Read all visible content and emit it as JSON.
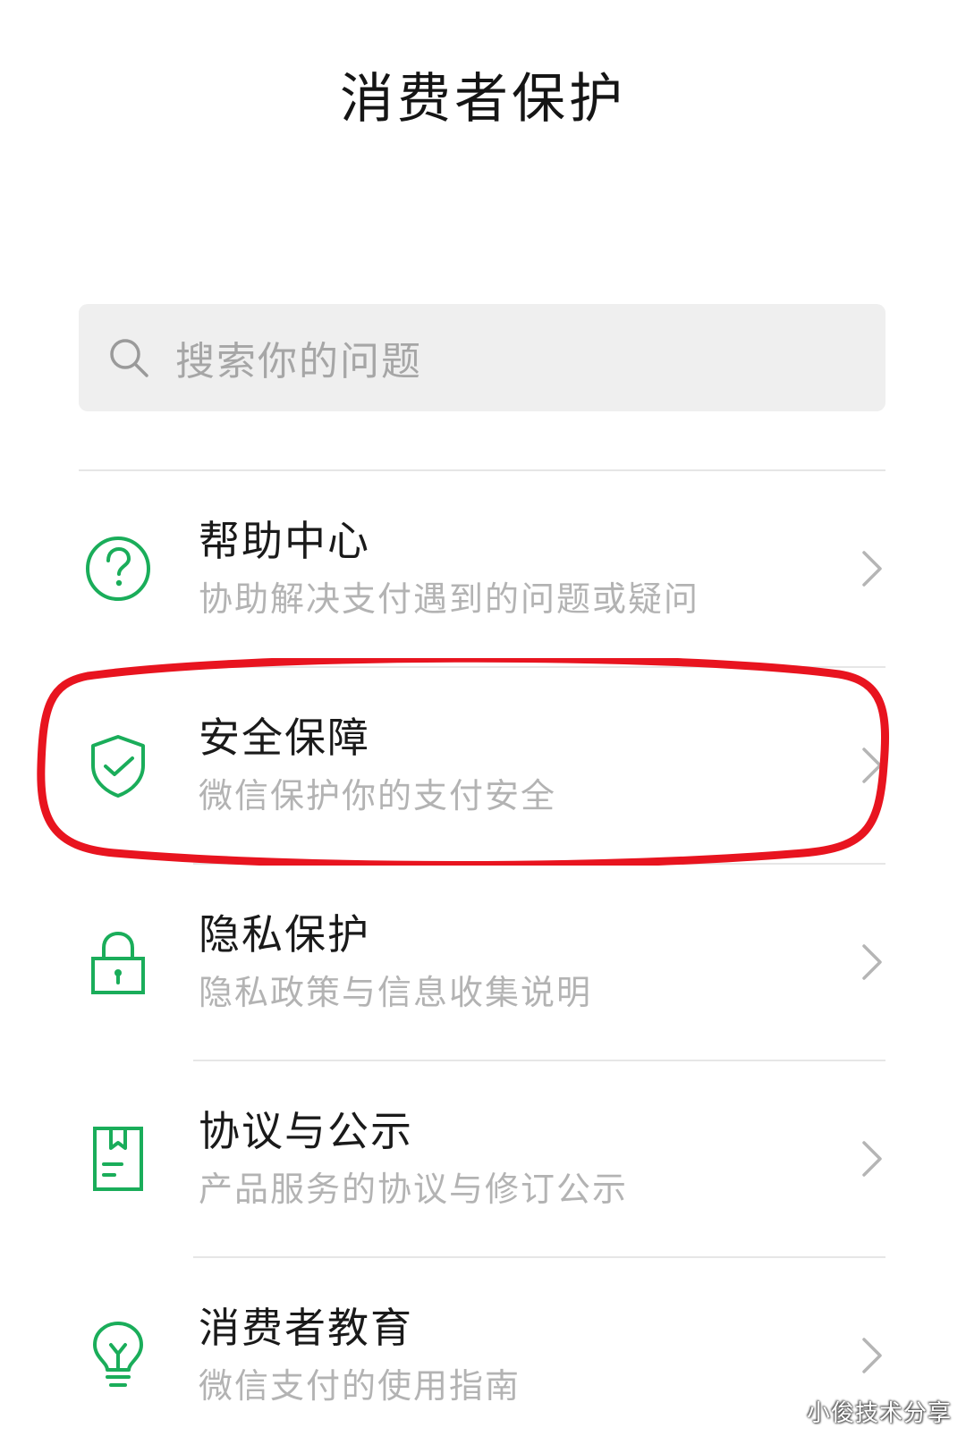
{
  "header": {
    "title": "消费者保护"
  },
  "search": {
    "placeholder": "搜索你的问题",
    "icon": "search-icon"
  },
  "menu": {
    "items": [
      {
        "title": "帮助中心",
        "subtitle": "协助解决支付遇到的问题或疑问",
        "icon": "help-question-icon"
      },
      {
        "title": "安全保障",
        "subtitle": "微信保护你的支付安全",
        "icon": "shield-check-icon"
      },
      {
        "title": "隐私保护",
        "subtitle": "隐私政策与信息收集说明",
        "icon": "lock-icon"
      },
      {
        "title": "协议与公示",
        "subtitle": "产品服务的协议与修订公示",
        "icon": "document-icon"
      },
      {
        "title": "消费者教育",
        "subtitle": "微信支付的使用指南",
        "icon": "lightbulb-icon"
      }
    ]
  },
  "annotation": {
    "highlighted_item": "安全保障",
    "color": "#e8141f"
  },
  "watermark": {
    "text": "小俊技术分享"
  },
  "colors": {
    "accent": "#1aad5a",
    "subtitle": "#b3b3b3",
    "search_bg": "#efefef"
  }
}
